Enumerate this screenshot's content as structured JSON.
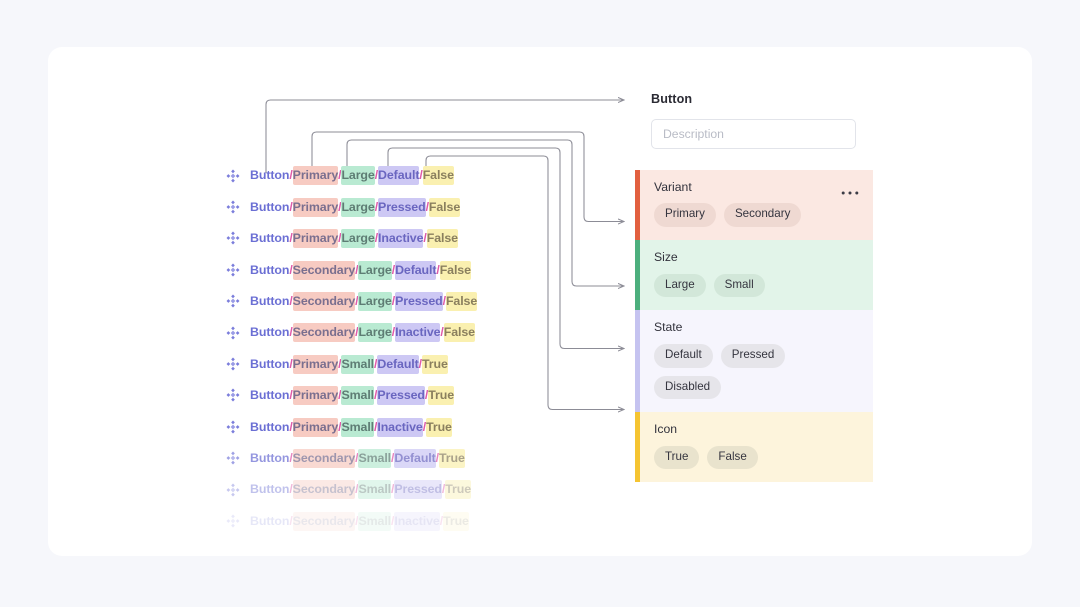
{
  "page": {
    "background_color": "#f6f7fb",
    "card_background": "#ffffff"
  },
  "variant_list": {
    "icon_name": "component-set-icon",
    "separator": "/",
    "rows": [
      {
        "base": "Button",
        "variant": "Primary",
        "size": "Large",
        "state": "Default",
        "icon": "False",
        "opacity": 1
      },
      {
        "base": "Button",
        "variant": "Primary",
        "size": "Large",
        "state": "Pressed",
        "icon": "False",
        "opacity": 1
      },
      {
        "base": "Button",
        "variant": "Primary",
        "size": "Large",
        "state": "Inactive",
        "icon": "False",
        "opacity": 1
      },
      {
        "base": "Button",
        "variant": "Secondary",
        "size": "Large",
        "state": "Default",
        "icon": "False",
        "opacity": 1
      },
      {
        "base": "Button",
        "variant": "Secondary",
        "size": "Large",
        "state": "Pressed",
        "icon": "False",
        "opacity": 1
      },
      {
        "base": "Button",
        "variant": "Secondary",
        "size": "Large",
        "state": "Inactive",
        "icon": "False",
        "opacity": 1
      },
      {
        "base": "Button",
        "variant": "Primary",
        "size": "Small",
        "state": "Default",
        "icon": "True",
        "opacity": 1
      },
      {
        "base": "Button",
        "variant": "Primary",
        "size": "Small",
        "state": "Pressed",
        "icon": "True",
        "opacity": 1
      },
      {
        "base": "Button",
        "variant": "Primary",
        "size": "Small",
        "state": "Inactive",
        "icon": "True",
        "opacity": 1
      },
      {
        "base": "Button",
        "variant": "Secondary",
        "size": "Small",
        "state": "Default",
        "icon": "True",
        "opacity": 0.72
      },
      {
        "base": "Button",
        "variant": "Secondary",
        "size": "Small",
        "state": "Pressed",
        "icon": "True",
        "opacity": 0.42
      },
      {
        "base": "Button",
        "variant": "Secondary",
        "size": "Small",
        "state": "Inactive",
        "icon": "True",
        "opacity": 0.16
      }
    ]
  },
  "properties_panel": {
    "title": "Button",
    "description": {
      "value": "",
      "placeholder": "Description"
    },
    "overflow_icon_name": "more-options-icon",
    "sections": [
      {
        "name": "Variant",
        "accent": "#e2603f",
        "has_menu": true,
        "options": [
          "Primary",
          "Secondary"
        ]
      },
      {
        "name": "Size",
        "accent": "#4caf7d",
        "has_menu": false,
        "options": [
          "Large",
          "Small"
        ]
      },
      {
        "name": "State",
        "accent": "#c5c3f0",
        "has_menu": false,
        "options": [
          "Default",
          "Pressed",
          "Disabled"
        ]
      },
      {
        "name": "Icon",
        "accent": "#f5c431",
        "has_menu": false,
        "options": [
          "True",
          "False"
        ]
      }
    ]
  },
  "connectors": {
    "stroke_color": "#8c8c96",
    "description": "Curved elbow connectors linking each name segment to its matching property section"
  }
}
